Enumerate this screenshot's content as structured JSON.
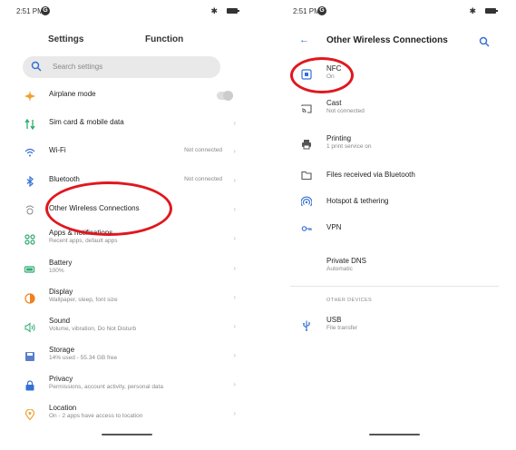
{
  "left": {
    "status": {
      "time": "2:51 PM",
      "g": "G"
    },
    "header": {
      "title": "Settings",
      "function": "Function"
    },
    "search": {
      "placeholder": "Search settings"
    },
    "items": [
      {
        "label": "Airplane mode",
        "subtitle": "",
        "value": ""
      },
      {
        "label": "Sim card & mobile data",
        "subtitle": "",
        "value": ""
      },
      {
        "label": "Wi-Fi",
        "subtitle": "",
        "value": "Not connected"
      },
      {
        "label": "Bluetooth",
        "subtitle": "",
        "value": "Not connected"
      },
      {
        "label": "Other Wireless Connections",
        "subtitle": "",
        "value": ""
      },
      {
        "label": "Apps & notifications",
        "subtitle": "Recent apps, default apps",
        "value": ""
      },
      {
        "label": "Battery",
        "subtitle": "100%",
        "value": ""
      },
      {
        "label": "Display",
        "subtitle": "Wallpaper, sleep, font size",
        "value": ""
      },
      {
        "label": "Sound",
        "subtitle": "Volume, vibration, Do Not Disturb",
        "value": ""
      },
      {
        "label": "Storage",
        "subtitle": "14% used - 55.34 GB free",
        "value": ""
      },
      {
        "label": "Privacy",
        "subtitle": "Permissions, account activity, personal data",
        "value": ""
      },
      {
        "label": "Location",
        "subtitle": "On - 2 apps have access to location",
        "value": ""
      }
    ]
  },
  "right": {
    "status": {
      "time": "2:51 PM",
      "g": "G"
    },
    "header": {
      "title": "Other Wireless Connections"
    },
    "items": [
      {
        "label": "NFC",
        "subtitle": "On"
      },
      {
        "label": "Cast",
        "subtitle": "Not connected"
      },
      {
        "label": "Printing",
        "subtitle": "1 print service on"
      },
      {
        "label": "Files received via Bluetooth",
        "subtitle": ""
      },
      {
        "label": "Hotspot & tethering",
        "subtitle": ""
      },
      {
        "label": "VPN",
        "subtitle": ""
      },
      {
        "label": "Private DNS",
        "subtitle": "Automatic"
      }
    ],
    "section_other": "OTHER DEVICES",
    "usb": {
      "label": "USB",
      "subtitle": "File transfer"
    }
  },
  "colors": {
    "accent_blue": "#3570d6",
    "annotation_red": "#e0171e"
  }
}
